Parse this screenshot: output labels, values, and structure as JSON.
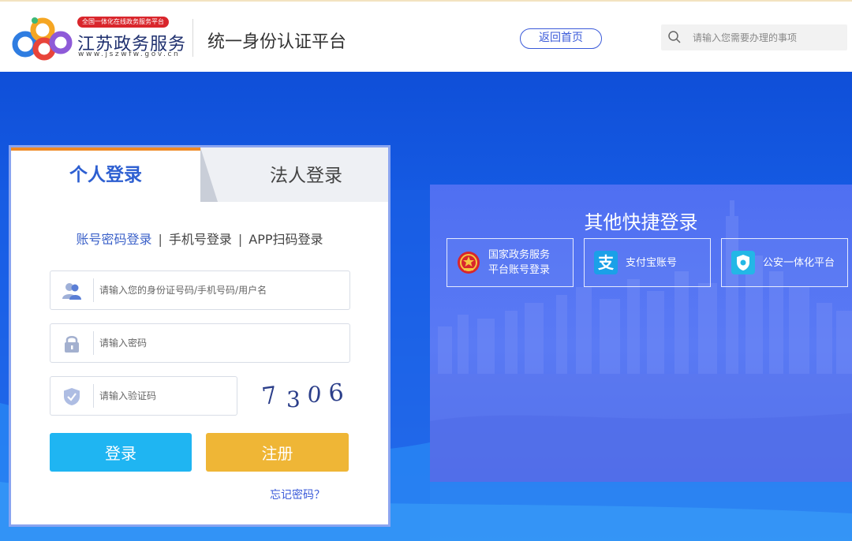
{
  "header": {
    "badge": "全国一体化在线政务服务平台",
    "brand_name": "江苏政务服务",
    "brand_url": "www.jszwfw.gov.cn",
    "platform_title": "统一身份认证平台",
    "home_button": "返回首页",
    "search_placeholder": "请输入您需要办理的事项"
  },
  "login": {
    "tabs": [
      {
        "label": "个人登录",
        "active": true
      },
      {
        "label": "法人登录",
        "active": false
      }
    ],
    "methods": [
      {
        "label": "账号密码登录",
        "active": true
      },
      {
        "label": "手机号登录",
        "active": false
      },
      {
        "label": "APP扫码登录",
        "active": false
      }
    ],
    "separator": "|",
    "fields": {
      "username_placeholder": "请输入您的身份证号码/手机号码/用户名",
      "password_placeholder": "请输入密码",
      "captcha_placeholder": "请输入验证码"
    },
    "captcha_text": "7306",
    "login_button": "登录",
    "register_button": "注册",
    "forgot_link": "忘记密码？"
  },
  "quick_login": {
    "title": "其他快捷登录",
    "options": [
      {
        "label": "国家政务服务\n平台账号登录",
        "icon": "national-emblem-icon"
      },
      {
        "label": "支付宝账号",
        "icon": "alipay-icon"
      },
      {
        "label": "公安一体化平台",
        "icon": "police-badge-icon"
      }
    ]
  },
  "colors": {
    "primary_blue": "#2d5fd1",
    "login_button": "#1fb5f2",
    "register_button": "#efb636",
    "tab_accent": "#f08a24",
    "hero_blue": "#1a5fe0"
  }
}
